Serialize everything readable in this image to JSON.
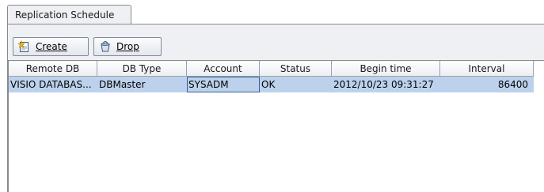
{
  "tabs": [
    {
      "label": "Replication Schedule",
      "active": true
    }
  ],
  "toolbar": {
    "create_label": "Create",
    "drop_label": "Drop",
    "create_icon": "create-new-icon",
    "drop_icon": "drop-bucket-icon"
  },
  "table": {
    "columns": [
      "Remote DB",
      "DB Type",
      "Account",
      "Status",
      "Begin time",
      "Interval"
    ],
    "rows": [
      {
        "remote_db": "VISIO DATABAS...",
        "db_type": "DBMaster",
        "account": "SYSADM",
        "status": "OK",
        "begin_time": "2012/10/23 09:31:27",
        "interval": "86400",
        "selected": true
      }
    ]
  },
  "colors": {
    "selection": "#bcd2ec",
    "panel_bg": "#eef0f3",
    "border": "#8a8a8a"
  }
}
